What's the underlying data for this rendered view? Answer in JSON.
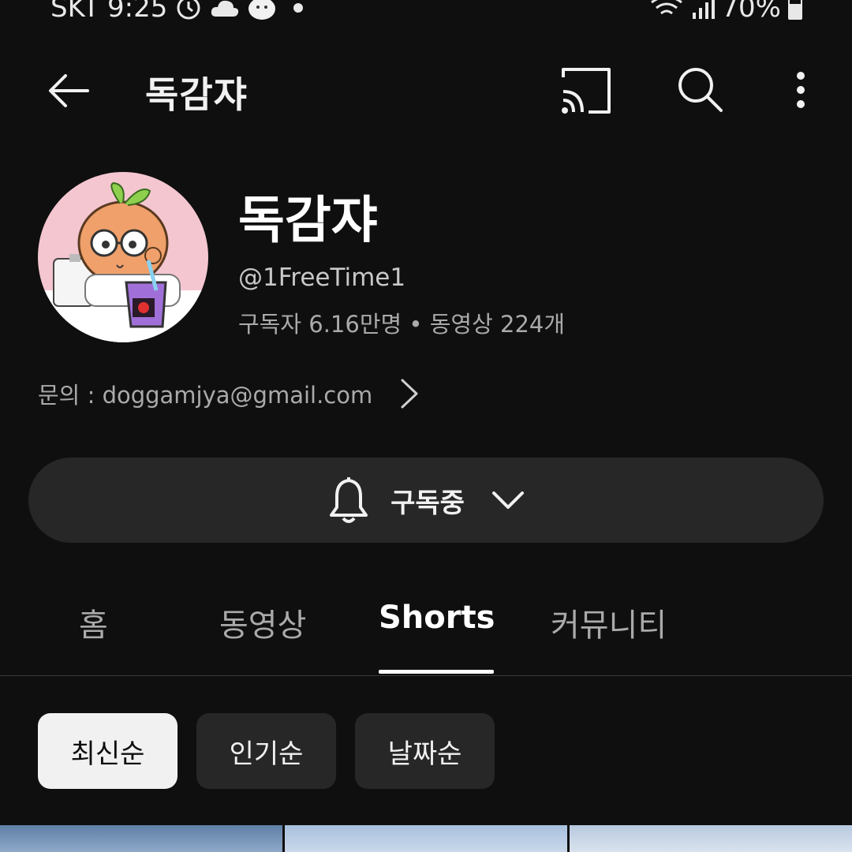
{
  "status_bar": {
    "carrier": "SKT",
    "time": "9:25",
    "battery": "70%",
    "icons": [
      "alarm-icon",
      "cloud-icon",
      "face-icon",
      "dot-icon",
      "wifi-icon",
      "signal-icon",
      "battery-icon"
    ]
  },
  "top_bar": {
    "title": "독감쟈",
    "icons": [
      "back-arrow-icon",
      "cast-icon",
      "search-icon",
      "more-vertical-icon"
    ]
  },
  "channel": {
    "name": "독감쟈",
    "handle": "@1FreeTime1",
    "stats": "구독자 6.16만명 • 동영상 224개",
    "about": "문의 : doggamjya@gmail.com"
  },
  "subscribe": {
    "label": "구독중",
    "icons": [
      "bell-icon",
      "chevron-down-icon"
    ]
  },
  "tabs": [
    {
      "label": "홈",
      "active": false
    },
    {
      "label": "동영상",
      "active": false
    },
    {
      "label": "Shorts",
      "active": true
    },
    {
      "label": "커뮤니티",
      "active": false
    }
  ],
  "sort_chips": [
    {
      "label": "최신순",
      "selected": true
    },
    {
      "label": "인기순",
      "selected": false
    },
    {
      "label": "날짜순",
      "selected": false
    }
  ],
  "colors": {
    "background": "#0f0f0f",
    "surface": "#272727",
    "text_primary": "#f1f1f1",
    "text_secondary": "#aaaaaa"
  }
}
